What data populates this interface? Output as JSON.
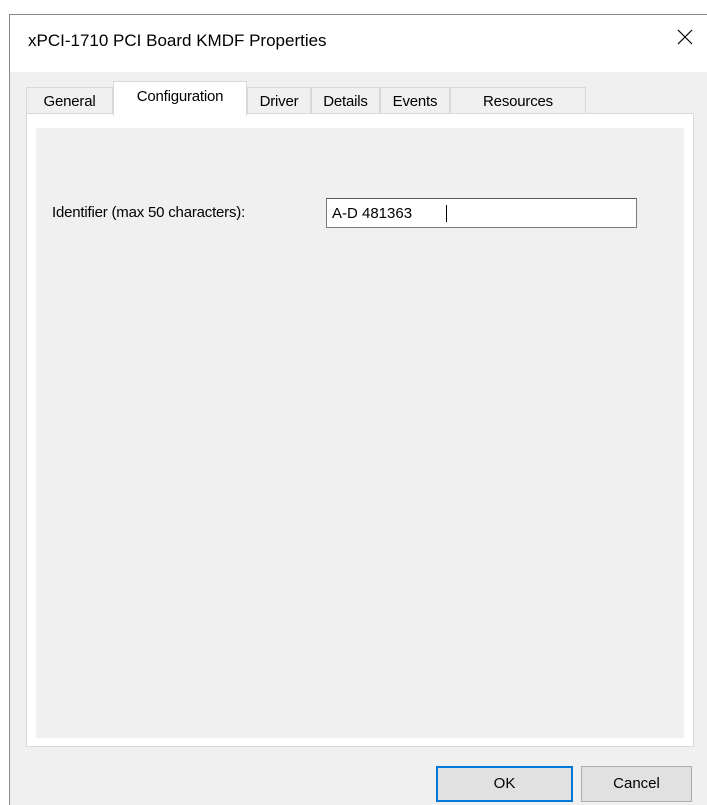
{
  "window": {
    "title": "xPCI-1710 PCI Board KMDF Properties"
  },
  "tabs": [
    {
      "label": "General",
      "active": false
    },
    {
      "label": "Configuration",
      "active": true
    },
    {
      "label": "Driver",
      "active": false
    },
    {
      "label": "Details",
      "active": false
    },
    {
      "label": "Events",
      "active": false
    },
    {
      "label": "Resources",
      "active": false
    }
  ],
  "configuration": {
    "identifier_label": "Identifier (max 50 characters):",
    "identifier_value": "A-D 481363"
  },
  "buttons": {
    "ok_label": "OK",
    "cancel_label": "Cancel"
  },
  "icons": {
    "close": "close-icon"
  }
}
